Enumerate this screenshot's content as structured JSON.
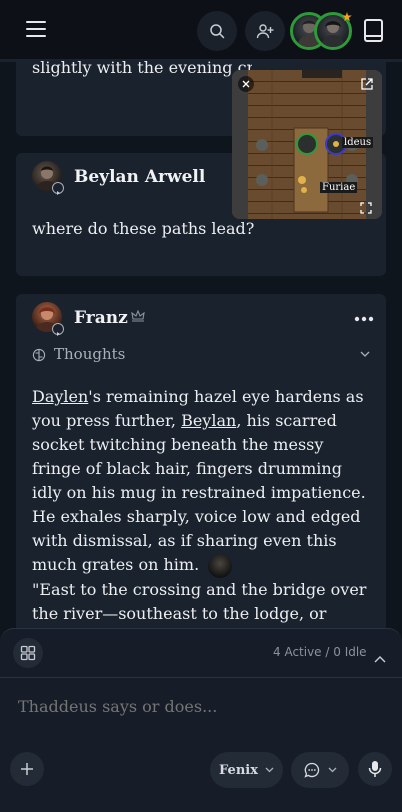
{
  "header": {
    "icons": [
      "menu-icon",
      "search-icon",
      "add-user-icon",
      "book-icon"
    ],
    "accent_color": "#2e9a3a",
    "star_color": "#f3a51f"
  },
  "messages": [
    {
      "partial_text": "slightly with the evening crowd."
    },
    {
      "author": "Beylan Arwell",
      "text": "where do these paths lead?"
    },
    {
      "author": "Franz",
      "thoughts_label": "Thoughts",
      "paragraph": {
        "link1": "Daylen",
        "part1": "'s remaining hazel eye hardens as you press further, ",
        "link2": "Beylan",
        "part2": ", his scarred socket twitching beneath the messy fringe of black hair, fingers drumming idly on his mug in restrained impatience. He exhales sharply, voice low and edged with dismissal, as if sharing even this much grates on him. ",
        "quote": "\"East to the crossing and the bridge over the river—southeast to the lodge, or deeper to the shrine and watchtower,\"  he mutters gruffly,"
      }
    }
  ],
  "map_popup": {
    "token_labels": [
      "Thaddeus",
      "Furiae"
    ],
    "visible_label_1": "ldeus",
    "visible_label_2": "Furiae"
  },
  "composer": {
    "status": "4 Active / 0 Idle",
    "placeholder": "Thaddeus says or does...",
    "model_label": "Fenix"
  }
}
